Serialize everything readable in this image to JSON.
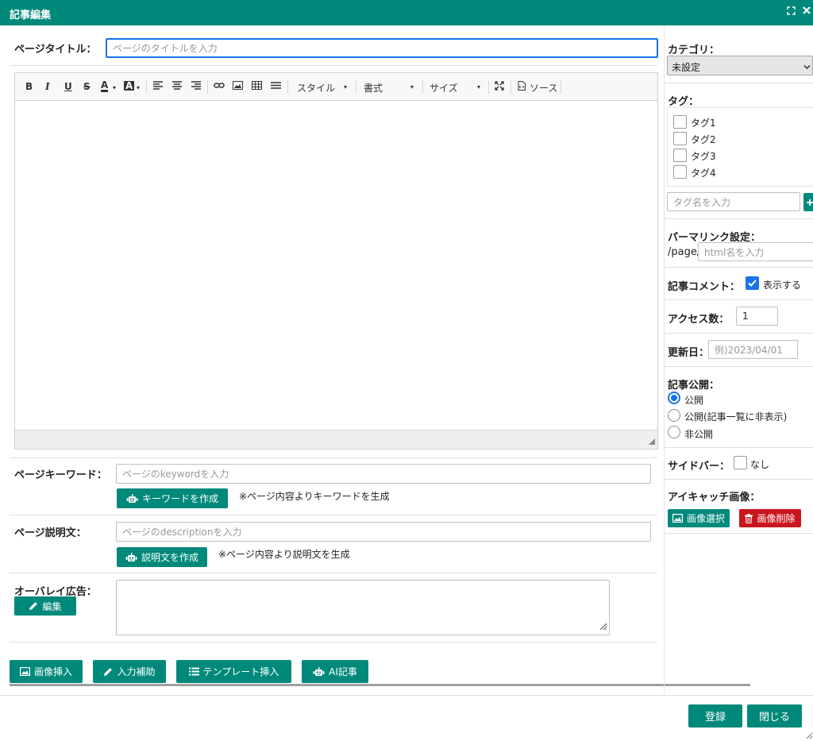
{
  "window": {
    "title": "記事編集",
    "expand_icon": "expand-icon",
    "close_icon": "close-icon"
  },
  "page_title": {
    "label": "ページタイトル：",
    "placeholder": "ページのタイトルを入力"
  },
  "toolbar": {
    "bold": "B",
    "italic": "I",
    "underline": "U",
    "strike": "S",
    "text_color": "A",
    "bg_color": "A",
    "style": "スタイル",
    "format": "書式",
    "size": "サイズ",
    "source": "ソース"
  },
  "keywords": {
    "label": "ページキーワード：",
    "placeholder": "ページのkeywordを入力",
    "button": "キーワードを作成",
    "note": "※ページ内容よりキーワードを生成"
  },
  "description": {
    "label": "ページ説明文：",
    "placeholder": "ページのdescriptionを入力",
    "button": "説明文を作成",
    "note": "※ページ内容より説明文を生成"
  },
  "overlay": {
    "label": "オーバレイ広告：",
    "edit_button": "編集"
  },
  "bottom_buttons": {
    "image_insert": "画像挿入",
    "input_assist": "入力補助",
    "template_insert": "テンプレート挿入",
    "ai_article": "AI記事"
  },
  "sidebar": {
    "category": {
      "label": "カテゴリ：",
      "selected": "未設定"
    },
    "tags": {
      "label": "タグ：",
      "items": [
        "タグ1",
        "タグ2",
        "タグ3",
        "タグ4"
      ],
      "input_placeholder": "タグ名を入力"
    },
    "permalink": {
      "label": "パーマリンク設定：",
      "prefix": "/page/",
      "placeholder": "html名を入力"
    },
    "comment": {
      "label": "記事コメント：",
      "checkbox_label": "表示する",
      "checked": true
    },
    "access": {
      "label": "アクセス数：",
      "value": "1"
    },
    "updated": {
      "label": "更新日：",
      "placeholder": "例)2023/04/01"
    },
    "publish": {
      "label": "記事公開：",
      "options": [
        "公開",
        "公開(記事一覧に非表示)",
        "非公開"
      ],
      "selected": 0
    },
    "sidebar_opt": {
      "label": "サイドバー：",
      "checkbox_label": "なし",
      "checked": false
    },
    "eyecatch": {
      "label": "アイキャッチ画像：",
      "select_button": "画像選択",
      "delete_button": "画像削除"
    }
  },
  "footer": {
    "register": "登録",
    "close": "閉じる"
  },
  "colors": {
    "accent": "#00897b",
    "danger": "#c9151e",
    "focus": "#1a73e8"
  }
}
